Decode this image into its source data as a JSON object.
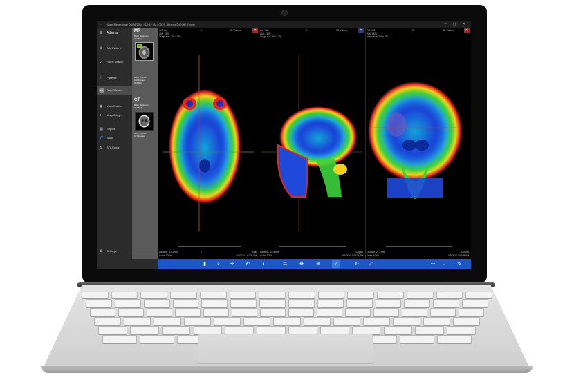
{
  "window": {
    "title": "Brain Melanoma | 06/26/2014 | 19:42 | M | 0019 - Athena DICOM Expert",
    "controls": "–  ▢  ✕"
  },
  "sidebar": {
    "app_name": "Athena",
    "items": [
      {
        "label": "Add Patient",
        "icon": "add-user-icon",
        "glyph": "⊕"
      },
      {
        "label": "PACS Search",
        "icon": "search-icon",
        "glyph": "⌕"
      },
      {
        "label": "Patients",
        "icon": "patients-icon",
        "glyph": "⚇"
      },
      {
        "label": "Brain Melan...",
        "icon": "avatar",
        "glyph": "BM"
      },
      {
        "label": "Visualization",
        "icon": "eye-icon",
        "glyph": "◉"
      },
      {
        "label": "Magnifying...",
        "icon": "magnifier-icon",
        "glyph": "⌕"
      },
      {
        "label": "Report",
        "icon": "report-icon",
        "glyph": "▤"
      },
      {
        "label": "Word",
        "icon": "word-icon",
        "glyph": "W"
      },
      {
        "label": "STL Export",
        "icon": "export-icon",
        "glyph": "⎙"
      }
    ],
    "settings": {
      "label": "Settings",
      "glyph": "⚙"
    }
  },
  "series": [
    {
      "modality": "MR",
      "study": "Brain Melanoma",
      "date": "05/08/14",
      "desc": "Axial Volume",
      "images": "180 Images",
      "date2": "05/08/14",
      "badge": "3D"
    },
    {
      "modality": "CT",
      "study": "Brain Melanoma",
      "date": "24/08/16",
      "desc": "Axial Volume",
      "images": "107 Images",
      "date2": ""
    }
  ],
  "viewports": [
    {
      "wc": "WC: 769",
      "ww": "WW: 1525",
      "size": "Image size: 256 x 256",
      "orient": "X",
      "vol": "3D Volume",
      "close": "✕",
      "loc": "Location: -15.3 mm",
      "scale": "Scale: 105%",
      "view": "Axial",
      "pos": "P",
      "date": "5/8/2014 1:07:05 PM"
    },
    {
      "wc": "WC: 768",
      "ww": "WW: 1525",
      "size": "Image size: 256 x 256",
      "orient": "S",
      "vol": "3D Volume",
      "close": "✕",
      "loc": "Location: -22.8 mm",
      "scale": "Scale: 105%",
      "view": "Sagittal",
      "pos": "",
      "date": "5/8/2014 1:07:05 PM"
    },
    {
      "wc": "WC: 909",
      "ww": "WW: 1525",
      "size": "Image size: 256 x 256",
      "orient": "S",
      "vol": "3D Volume",
      "close": "✕",
      "loc": "Location: 21.3 mm",
      "scale": "Scale: 105%",
      "view": "Coronal",
      "pos": "",
      "date": "5/8/2014 1:07:05 PM"
    }
  ],
  "toolbar": {
    "tools": [
      "▮",
      "⌕",
      "✢",
      "↶",
      "◐",
      "⇆",
      "✥",
      "⊕",
      "⟋",
      "↻",
      "⤢",
      "⋯",
      "↔",
      "✎"
    ]
  },
  "colors": {
    "accent": "#1b57c6",
    "sidebar": "#2b2b2b",
    "series_panel": "#5a5a5a",
    "selected_badge": "#8dc63f",
    "close_red": "#b71c1c"
  }
}
